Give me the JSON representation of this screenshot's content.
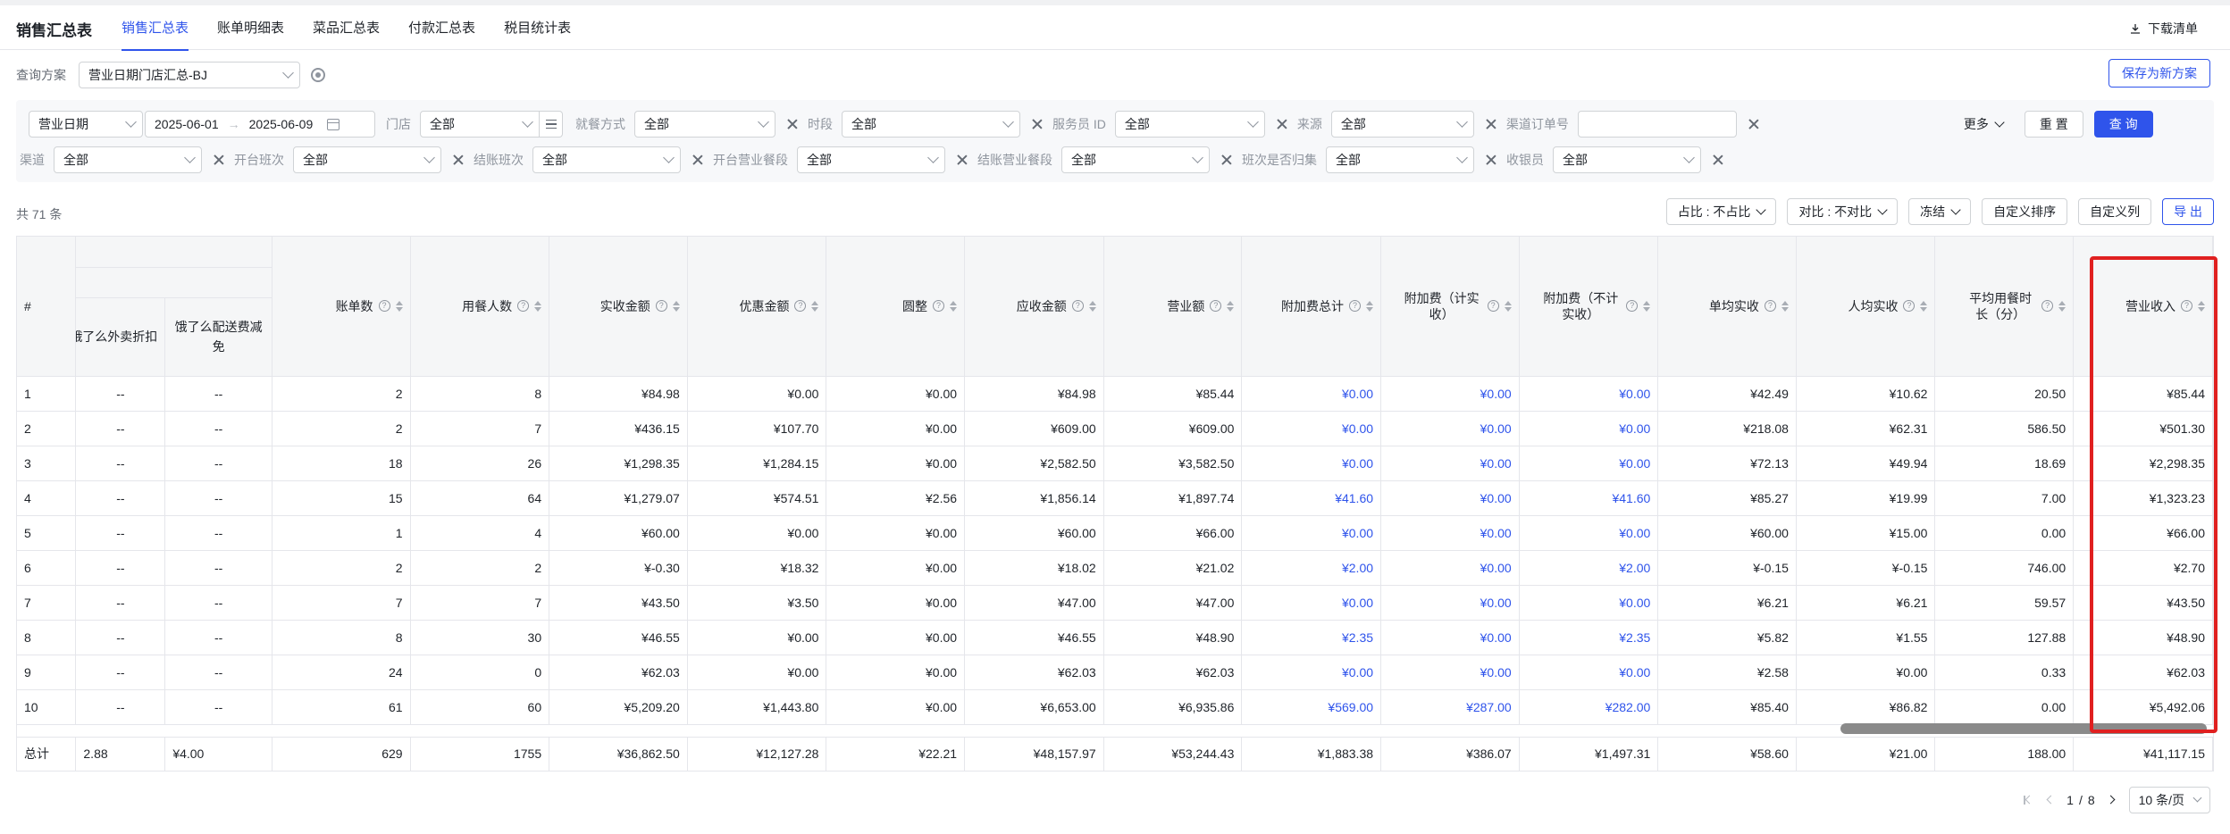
{
  "header": {
    "app_title": "销售汇总表",
    "tabs": [
      {
        "label": "销售汇总表",
        "active": true
      },
      {
        "label": "账单明细表",
        "active": false
      },
      {
        "label": "菜品汇总表",
        "active": false
      },
      {
        "label": "付款汇总表",
        "active": false
      },
      {
        "label": "税目统计表",
        "active": false
      }
    ],
    "download_label": "下载清单"
  },
  "scheme": {
    "label": "查询方案",
    "value": "营业日期门店汇总-BJ",
    "save_button": "保存为新方案"
  },
  "filters": {
    "row1": {
      "date_type": "营业日期",
      "date_start": "2025-06-01",
      "date_sep": "→",
      "date_end": "2025-06-09",
      "store_label": "门店",
      "store_value": "全部",
      "dining_label": "就餐方式",
      "dining_value": "全部",
      "period_label": "时段",
      "period_value": "全部",
      "waiter_label": "服务员 ID",
      "waiter_value": "全部",
      "source_label": "来源",
      "source_value": "全部",
      "channel_order_label": "渠道订单号",
      "channel_order_value": "",
      "more_label": "更多",
      "reset_button": "重 置",
      "query_button": "查 询"
    },
    "row2": {
      "channel_label": "渠道",
      "channel_value": "全部",
      "open_shift_label": "开台班次",
      "open_shift_value": "全部",
      "settle_shift_label": "结账班次",
      "settle_shift_value": "全部",
      "open_meal_label": "开台营业餐段",
      "open_meal_value": "全部",
      "settle_meal_label": "结账营业餐段",
      "settle_meal_value": "全部",
      "shift_archived_label": "班次是否归集",
      "shift_archived_value": "全部",
      "cashier_label": "收银员",
      "cashier_value": "全部"
    }
  },
  "summary": {
    "count_text": "共 71 条",
    "ratio_button": "占比 : 不占比",
    "compare_button": "对比 : 不对比",
    "freeze_button": "冻结",
    "custom_sort_button": "自定义排序",
    "custom_cols_button": "自定义列",
    "export_button": "导 出"
  },
  "table": {
    "index_header": "#",
    "frozen_headers": [
      "饿了么外卖折扣",
      "饿了么配送费减免"
    ],
    "headers": [
      {
        "label": "账单数",
        "help": true
      },
      {
        "label": "用餐人数",
        "help": true
      },
      {
        "label": "实收金额",
        "help": true
      },
      {
        "label": "优惠金额",
        "help": true
      },
      {
        "label": "圆整",
        "help": true
      },
      {
        "label": "应收金额",
        "help": true
      },
      {
        "label": "营业额",
        "help": true
      },
      {
        "label": "附加费总计",
        "help": true
      },
      {
        "label": "附加费（计实收）",
        "help": true
      },
      {
        "label": "附加费（不计实收）",
        "help": true
      },
      {
        "label": "单均实收",
        "help": true
      },
      {
        "label": "人均实收",
        "help": true
      },
      {
        "label": "平均用餐时长（分）",
        "help": true
      },
      {
        "label": "营业收入",
        "help": true
      }
    ],
    "rows": [
      {
        "idx": "1",
        "f1": "--",
        "f2": "--",
        "v": [
          "2",
          "8",
          "¥84.98",
          "¥0.00",
          "¥0.00",
          "¥84.98",
          "¥85.44",
          "¥0.00",
          "¥0.00",
          "¥0.00",
          "¥42.49",
          "¥10.62",
          "20.50",
          "¥85.44"
        ]
      },
      {
        "idx": "2",
        "f1": "--",
        "f2": "--",
        "v": [
          "2",
          "7",
          "¥436.15",
          "¥107.70",
          "¥0.00",
          "¥609.00",
          "¥609.00",
          "¥0.00",
          "¥0.00",
          "¥0.00",
          "¥218.08",
          "¥62.31",
          "586.50",
          "¥501.30"
        ]
      },
      {
        "idx": "3",
        "f1": "--",
        "f2": "--",
        "v": [
          "18",
          "26",
          "¥1,298.35",
          "¥1,284.15",
          "¥0.00",
          "¥2,582.50",
          "¥3,582.50",
          "¥0.00",
          "¥0.00",
          "¥0.00",
          "¥72.13",
          "¥49.94",
          "18.69",
          "¥2,298.35"
        ]
      },
      {
        "idx": "4",
        "f1": "--",
        "f2": "--",
        "v": [
          "15",
          "64",
          "¥1,279.07",
          "¥574.51",
          "¥2.56",
          "¥1,856.14",
          "¥1,897.74",
          "¥41.60",
          "¥0.00",
          "¥41.60",
          "¥85.27",
          "¥19.99",
          "7.00",
          "¥1,323.23"
        ]
      },
      {
        "idx": "5",
        "f1": "--",
        "f2": "--",
        "v": [
          "1",
          "4",
          "¥60.00",
          "¥0.00",
          "¥0.00",
          "¥60.00",
          "¥66.00",
          "¥0.00",
          "¥0.00",
          "¥0.00",
          "¥60.00",
          "¥15.00",
          "0.00",
          "¥66.00"
        ]
      },
      {
        "idx": "6",
        "f1": "--",
        "f2": "--",
        "v": [
          "2",
          "2",
          "¥-0.30",
          "¥18.32",
          "¥0.00",
          "¥18.02",
          "¥21.02",
          "¥2.00",
          "¥0.00",
          "¥2.00",
          "¥-0.15",
          "¥-0.15",
          "746.00",
          "¥2.70"
        ]
      },
      {
        "idx": "7",
        "f1": "--",
        "f2": "--",
        "v": [
          "7",
          "7",
          "¥43.50",
          "¥3.50",
          "¥0.00",
          "¥47.00",
          "¥47.00",
          "¥0.00",
          "¥0.00",
          "¥0.00",
          "¥6.21",
          "¥6.21",
          "59.57",
          "¥43.50"
        ]
      },
      {
        "idx": "8",
        "f1": "--",
        "f2": "--",
        "v": [
          "8",
          "30",
          "¥46.55",
          "¥0.00",
          "¥0.00",
          "¥46.55",
          "¥48.90",
          "¥2.35",
          "¥0.00",
          "¥2.35",
          "¥5.82",
          "¥1.55",
          "127.88",
          "¥48.90"
        ]
      },
      {
        "idx": "9",
        "f1": "--",
        "f2": "--",
        "v": [
          "24",
          "0",
          "¥62.03",
          "¥0.00",
          "¥0.00",
          "¥62.03",
          "¥62.03",
          "¥0.00",
          "¥0.00",
          "¥0.00",
          "¥2.58",
          "¥0.00",
          "0.33",
          "¥62.03"
        ]
      },
      {
        "idx": "10",
        "f1": "--",
        "f2": "--",
        "v": [
          "61",
          "60",
          "¥5,209.20",
          "¥1,443.80",
          "¥0.00",
          "¥6,653.00",
          "¥6,935.86",
          "¥569.00",
          "¥287.00",
          "¥282.00",
          "¥85.40",
          "¥86.82",
          "0.00",
          "¥5,492.06"
        ]
      }
    ],
    "total": {
      "label": "总计",
      "f1": "2.88",
      "f2": "¥4.00",
      "v": [
        "629",
        "1755",
        "¥36,862.50",
        "¥12,127.28",
        "¥22.21",
        "¥48,157.97",
        "¥53,244.43",
        "¥1,883.38",
        "¥386.07",
        "¥1,497.31",
        "¥58.60",
        "¥21.00",
        "188.00",
        "¥41,117.15"
      ]
    }
  },
  "pagination": {
    "current": "1",
    "sep": "/",
    "total_pages": "8",
    "page_size": "10 条/页"
  },
  "colors": {
    "accent": "#2f54eb",
    "highlight": "#e02020"
  }
}
